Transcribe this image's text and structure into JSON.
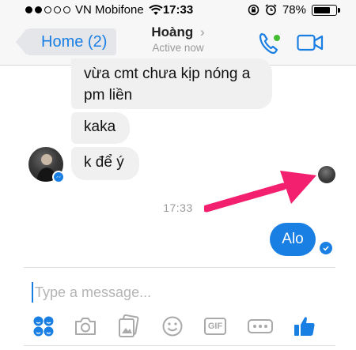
{
  "status_bar": {
    "carrier": "VN Mobifone",
    "time": "17:33",
    "battery": "78%",
    "battery_level": 0.78,
    "signal_bars_filled": 2,
    "signal_bars_total": 5
  },
  "nav": {
    "back_label": "Home (2)",
    "contact_name": "Hoàng",
    "contact_chevron": "›",
    "contact_status": "Active now",
    "icons": [
      "phone-icon",
      "video-camera-icon"
    ]
  },
  "messages": {
    "incoming": [
      {
        "lines": [
          "vừa cmt chưa kịp nóng a",
          "pm liền"
        ]
      },
      {
        "text": "kaka"
      },
      {
        "text": "k để ý"
      }
    ],
    "timestamp": "17:33",
    "outgoing": {
      "text": "Alo"
    }
  },
  "composer": {
    "placeholder": "Type a message...",
    "value": "",
    "gif_label": "GIF",
    "tools": [
      "stickers-icon",
      "camera-icon",
      "photos-icon",
      "emoji-icon",
      "gif-icon",
      "more-icon",
      "thumbs-up-icon"
    ]
  },
  "colors": {
    "accent": "#1a7fe3",
    "incoming_bubble": "#f0f0f0",
    "active_dot": "#44bd32",
    "annotation_arrow": "#f2206e"
  }
}
